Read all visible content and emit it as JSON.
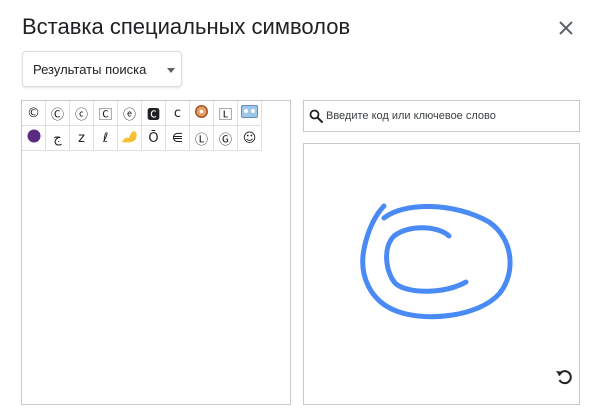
{
  "dialog": {
    "title": "Вставка специальных символов"
  },
  "category_dropdown": {
    "selected": "Результаты поиска"
  },
  "search": {
    "placeholder": "Введите код или ключевое слово",
    "value": ""
  },
  "results": {
    "symbols": [
      {
        "char": "©",
        "kind": "text"
      },
      {
        "char": "Ⓒ",
        "kind": "text"
      },
      {
        "char": "ⓒ",
        "kind": "text"
      },
      {
        "char": "🄲",
        "kind": "text"
      },
      {
        "char": "ⓔ",
        "kind": "text"
      },
      {
        "char": "🅲",
        "kind": "text"
      },
      {
        "char": "ᴄ",
        "kind": "text"
      },
      {
        "char": "🍩",
        "kind": "donut"
      },
      {
        "char": "🄻",
        "kind": "text"
      },
      {
        "char": "📼",
        "kind": "cassette"
      },
      {
        "char": "🟣",
        "kind": "purple-circle"
      },
      {
        "char": "ج",
        "kind": "text"
      },
      {
        "char": "ᴢ",
        "kind": "text"
      },
      {
        "char": "ℓ",
        "kind": "text"
      },
      {
        "char": "💪",
        "kind": "biceps"
      },
      {
        "char": "Ō",
        "kind": "text"
      },
      {
        "char": "⋹",
        "kind": "text"
      },
      {
        "char": "Ⓛ",
        "kind": "text"
      },
      {
        "char": "Ⓖ",
        "kind": "text"
      },
      {
        "char": "☺",
        "kind": "text"
      }
    ]
  },
  "drawing": {
    "stroke_color": "#4a8af4"
  },
  "colors": {
    "border": "#c8c8c8",
    "icon": "#5f6368",
    "text": "#202124"
  }
}
